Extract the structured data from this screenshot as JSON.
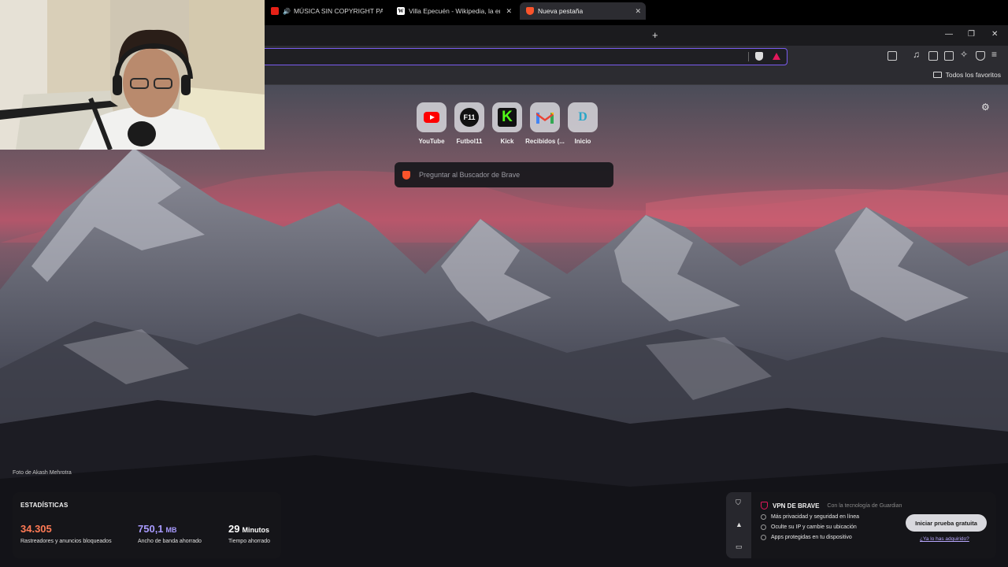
{
  "tabs": [
    {
      "title": "MÚSICA SIN COPYRIGHT PARA JUEGOS",
      "favicon": "youtube-icon",
      "audio": true
    },
    {
      "title": "Villa Epecuén - Wikipedia, la enciclopedia libre",
      "favicon": "wikipedia-icon"
    },
    {
      "title": "Nueva pestaña",
      "favicon": "brave-icon",
      "active": true
    }
  ],
  "new_tab_glyph": "+",
  "window": {
    "minimize": "—",
    "restore": "❐",
    "close": "✕"
  },
  "bookmarks": {
    "all_label": "Todos los favoritos"
  },
  "top_sites": [
    {
      "label": "YouTube",
      "icon": "youtube-icon"
    },
    {
      "label": "Futbol11",
      "icon": "futbol11-icon",
      "mark": "F11"
    },
    {
      "label": "Kick",
      "icon": "kick-icon",
      "mark": "K"
    },
    {
      "label": "Recibidos (...",
      "icon": "gmail-icon"
    },
    {
      "label": "Inicio",
      "icon": "disney-plus-icon",
      "mark": "D"
    }
  ],
  "search": {
    "placeholder": "Preguntar al Buscador de Brave"
  },
  "photo_credit": "Foto de Akash Mehrotra",
  "stats": {
    "title": "ESTADÍSTICAS",
    "trackers": {
      "value": "34.305",
      "label": "Rastreadores y anuncios bloqueados",
      "color": "#ff7a55"
    },
    "bandwidth": {
      "value": "750,1",
      "unit": "MB",
      "label": "Ancho de banda ahorrado",
      "color": "#a99bff"
    },
    "time": {
      "value": "29",
      "unit": "Minutos",
      "label": "Tiempo ahorrado"
    }
  },
  "vpn": {
    "title": "VPN DE BRAVE",
    "powered_by": "Con la tecnología de Guardian",
    "features": [
      "Más privacidad y seguridad en línea",
      "Oculte su IP y cambie su ubicación",
      "Apps protegidas en tu dispositivo"
    ],
    "cta": "Iniciar prueba gratuita",
    "link": "¿Ya lo has adquirido?"
  },
  "colors": {
    "accent": "#7a5cf0",
    "brave": "#fb542b",
    "tab_bg": "#2c2c31"
  }
}
